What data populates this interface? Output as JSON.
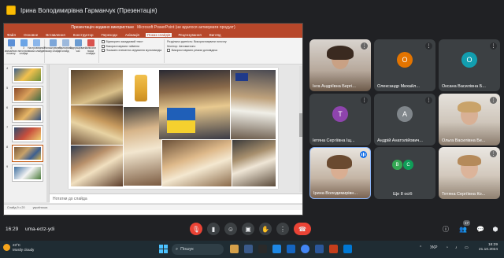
{
  "presenter_bar": {
    "title": "Ірина Володимирівна Гарманчук (Презентація)"
  },
  "powerpoint": {
    "title": "Презентація недавно використане",
    "title_suffix": "Microsoft PowerPoint (не вдалося активувати продукт)",
    "tabs": [
      "Файл",
      "Основне",
      "Вставлення",
      "Конструктор",
      "Переходи",
      "Анімація",
      "Показ слайдів",
      "Рецензування",
      "Вигляд"
    ],
    "ribbon": {
      "buttons": [
        "Зі звичайного початку",
        "З поточного слайда",
        "Настроюваний показ слайдів",
        "Налаштування показу слайдів",
        "Приховати слайд",
        "Відпрацювати час",
        "Записати показ слайдів"
      ],
      "options": [
        "Відтворити закадровий текст",
        "Використовувати таймінги",
        "Показати елементи керування мультимедіа",
        "Роздільна здатність: Використовувати поточну",
        "Монітор: Автоматично",
        "Використовувати режим доповідача"
      ]
    },
    "thumb_numbers": [
      "4",
      "5",
      "6",
      "7",
      "8",
      "9"
    ],
    "notes_placeholder": "Нотатки до слайда",
    "status": [
      "Слайд 9 з 20",
      "українська"
    ]
  },
  "participants": [
    {
      "name": "Інга Андріївна Бергі...",
      "type": "video"
    },
    {
      "name": "Олександр Михайл...",
      "type": "avatar",
      "initial": "О",
      "color": "#e37400"
    },
    {
      "name": "Оксана Василівна Б...",
      "type": "avatar",
      "initial": "О",
      "color": "#129eaf"
    },
    {
      "name": "Іетяна Сергіївна Іщ...",
      "type": "avatar",
      "initial": "Т",
      "color": "#8e44ad"
    },
    {
      "name": "Андрій Анатолійович...",
      "type": "avatar",
      "initial": "А",
      "color": "#80868b"
    },
    {
      "name": "Ольга Василівна Бе...",
      "type": "video"
    },
    {
      "name": "Ірина Володимирівн...",
      "type": "video",
      "speaking": true
    },
    {
      "name": "Ще 8 осіб",
      "type": "group",
      "initials": [
        "В",
        "С"
      ]
    },
    {
      "name": "Тетяна Сергіївна Ко...",
      "type": "video"
    }
  ],
  "callbar": {
    "time": "16:29",
    "meeting_code": "uma-ectz-ydi",
    "participant_count": "17"
  },
  "taskbar": {
    "weather_temp": "23°C",
    "weather_desc": "Mostly cloudy",
    "search_placeholder": "Пошук",
    "lang": "УКР",
    "time": "16:29",
    "date": "21.10.2024"
  }
}
